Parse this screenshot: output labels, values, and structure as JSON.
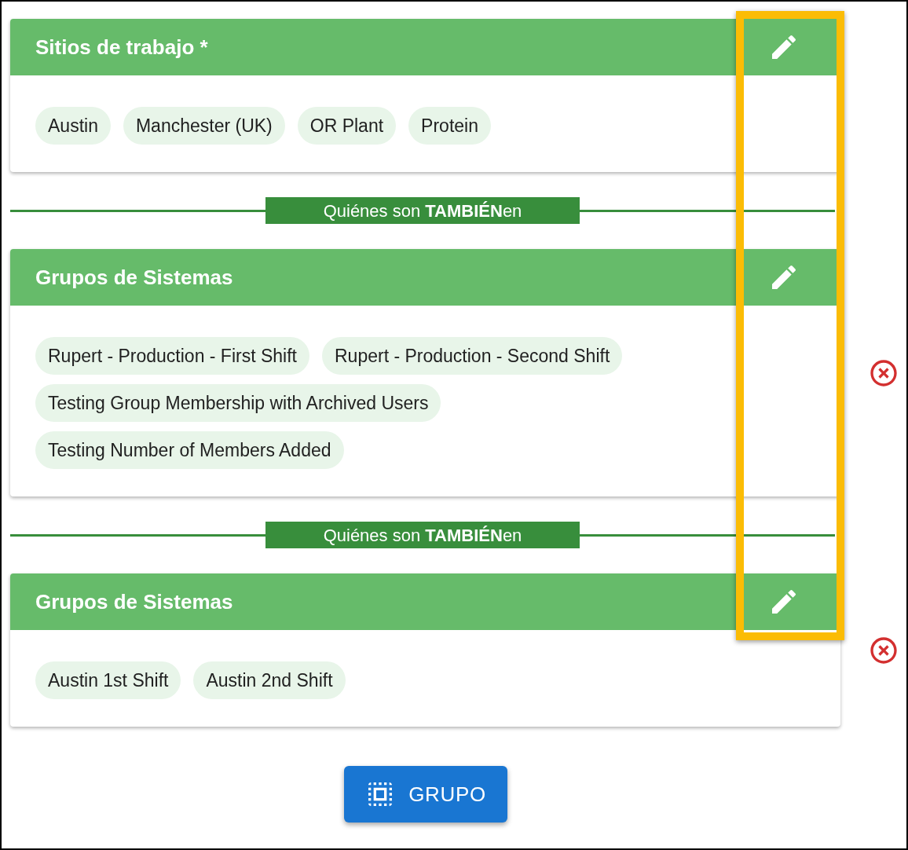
{
  "sections": [
    {
      "kind": "card",
      "title": "Sitios de trabajo *",
      "removable": false,
      "chips": [
        "Austin",
        "Manchester (UK)",
        "OR Plant",
        "Protein"
      ]
    },
    {
      "kind": "divider",
      "text": "Quiénes son **TAMBIÉN**en"
    },
    {
      "kind": "card",
      "title": "Grupos de Sistemas",
      "removable": true,
      "chips": [
        "Rupert - Production - First Shift",
        "Rupert - Production - Second Shift",
        "Testing Group Membership with Archived Users",
        "Testing Number of Members Added"
      ]
    },
    {
      "kind": "divider",
      "text": "Quiénes son **TAMBIÉN**en"
    },
    {
      "kind": "card",
      "title": "Grupos de Sistemas",
      "removable": true,
      "chips": [
        "Austin 1st Shift",
        "Austin 2nd Shift"
      ]
    }
  ],
  "edit_column_highlighted": true,
  "add_button": {
    "label": "GRUPO"
  }
}
